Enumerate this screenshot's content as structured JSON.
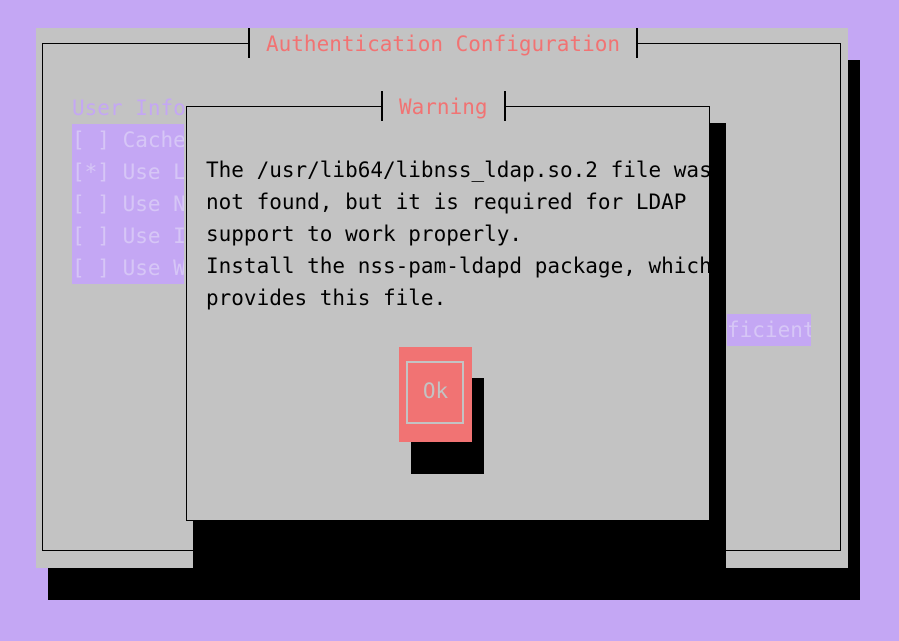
{
  "main_window": {
    "title": "Authentication Configuration",
    "user_info_label": "User Info",
    "options": [
      "[ ] Cache",
      "[*] Use L",
      "[ ] Use N",
      "[ ] Use I",
      "[ ] Use W"
    ],
    "partial_option": "ficient"
  },
  "dialog": {
    "title": "Warning",
    "message_lines": [
      "The /usr/lib64/libnss_ldap.so.2 file was",
      "not found, but it is required for LDAP",
      "support to work properly.",
      "Install the nss-pam-ldapd package, which",
      "provides this file."
    ],
    "ok_label": "Ok"
  },
  "colors": {
    "background": "#c4a7f4",
    "window": "#c3c3c3",
    "title_text": "#f17373",
    "button": "#f17373"
  }
}
